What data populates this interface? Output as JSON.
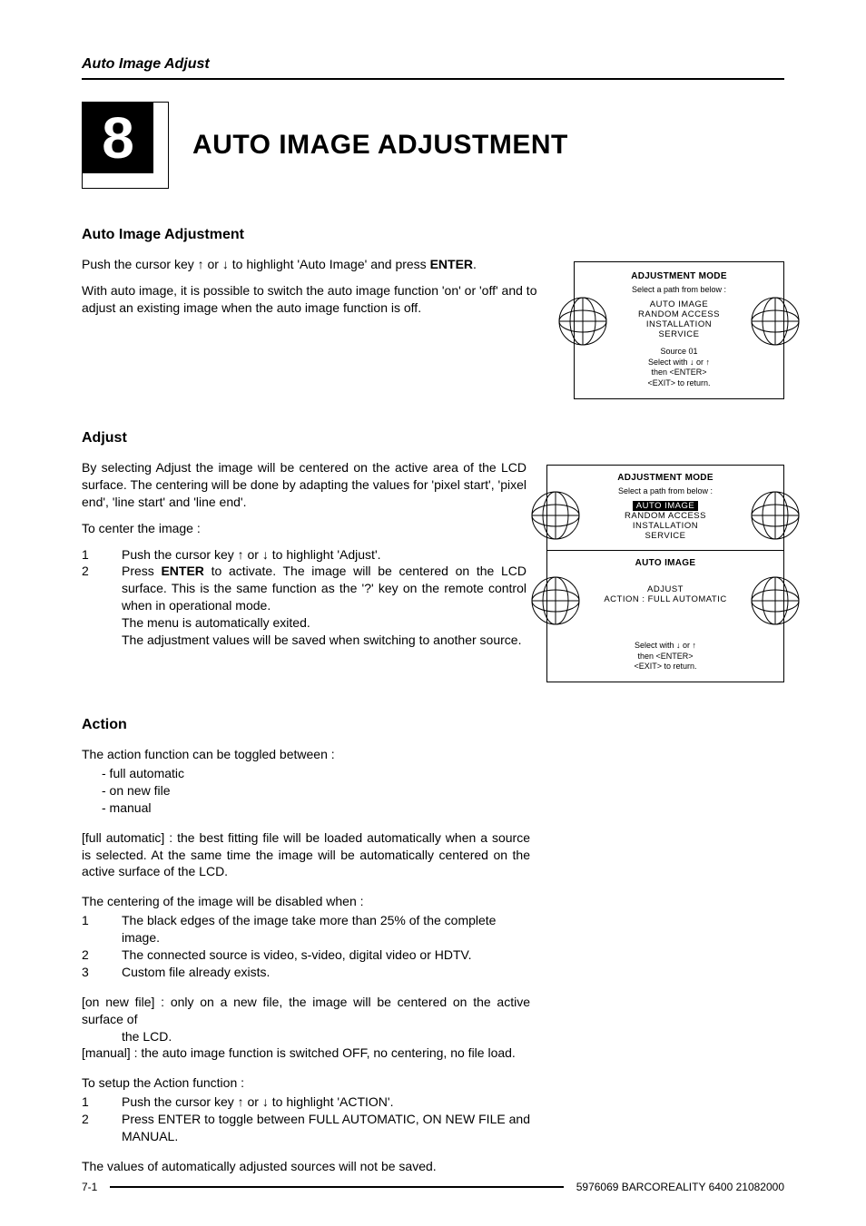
{
  "header": {
    "running": "Auto Image Adjust"
  },
  "chapter": {
    "number": "8",
    "title": "AUTO IMAGE ADJUSTMENT"
  },
  "s1": {
    "title": "Auto Image Adjustment",
    "p1a": "Push the cursor key ",
    "p1b": " or ",
    "p1c": " to highlight 'Auto Image' and press ",
    "p1d": "ENTER",
    "p1e": ".",
    "p2": "With auto image, it is possible to switch the auto image function 'on' or 'off' and to adjust an existing image when the auto image function is off."
  },
  "menu1": {
    "title": "ADJUSTMENT MODE",
    "sub": "Select a path from below :",
    "opt1": "AUTO IMAGE",
    "opt2": "RANDOM ACCESS",
    "opt3": "INSTALLATION",
    "opt4": "SERVICE",
    "src": "Source 01",
    "f1a": "Select with ",
    "f1b": " or ",
    "f2": "then <ENTER>",
    "f3": "<EXIT> to return."
  },
  "s2": {
    "title": "Adjust",
    "p1": "By selecting Adjust the image will be centered on the active area of the LCD surface. The centering will be done by adapting the values for 'pixel start', 'pixel end', 'line start' and 'line end'.",
    "lead": "To center the image :",
    "n1": "1",
    "r1a": "Push the cursor key ",
    "r1b": " or ",
    "r1c": " to highlight 'Adjust'.",
    "n2": "2",
    "r2a": "Press ",
    "r2b": "ENTER",
    "r2c": " to activate.  The image will be centered on the LCD surface. This is the same function as the '?' key on the remote control when in operational mode.",
    "r2d": "The menu is automatically exited.",
    "r2e": "The adjustment values will be saved when switching to another source."
  },
  "menu2": {
    "top": {
      "title": "ADJUSTMENT MODE",
      "sub": "Select a path from below :",
      "hl": "AUTO IMAGE",
      "opt2": "RANDOM ACCESS",
      "opt3": "INSTALLATION",
      "opt4": "SERVICE"
    },
    "bot": {
      "title": "AUTO IMAGE",
      "l1": "ADJUST",
      "l2": "ACTION : FULL AUTOMATIC",
      "f1a": "Select with ",
      "f1b": " or ",
      "f2": "then <ENTER>",
      "f3": "<EXIT> to return."
    }
  },
  "s3": {
    "title": "Action",
    "p1": "The action function can be toggled between :",
    "d1": "- full automatic",
    "d2": "- on new file",
    "d3": "- manual",
    "p2": "[full automatic] : the best fitting file will be loaded automatically when a source is selected. At the same time the image will be automatically centered on the active surface of the LCD.",
    "lead2": "The centering of the image will be disabled when :",
    "n1": "1",
    "r1": "The black edges of the image take more than 25% of the complete image.",
    "n2": "2",
    "r2": "The connected source is video, s-video, digital video or HDTV.",
    "n3": "3",
    "r3": "Custom file already exists.",
    "p3a": "[on new file] : only on a new file, the image will be centered on the active surface of",
    "p3b": "the LCD.",
    "p4": "[manual] : the auto image function is switched OFF, no centering, no file load.",
    "lead3": "To setup the Action function :",
    "sn1": "1",
    "sr1a": "Push the cursor key ",
    "sr1b": " or ",
    "sr1c": " to highlight 'ACTION'.",
    "sn2": "2",
    "sr2": "Press ENTER to toggle between FULL AUTOMATIC, ON NEW FILE and MANUAL.",
    "p5": "The values of automatically adjusted sources will not be saved."
  },
  "footer": {
    "left": "7-1",
    "right": "5976069 BARCOREALITY 6400 21082000"
  },
  "glyphs": {
    "up": "↑",
    "down": "↓"
  }
}
